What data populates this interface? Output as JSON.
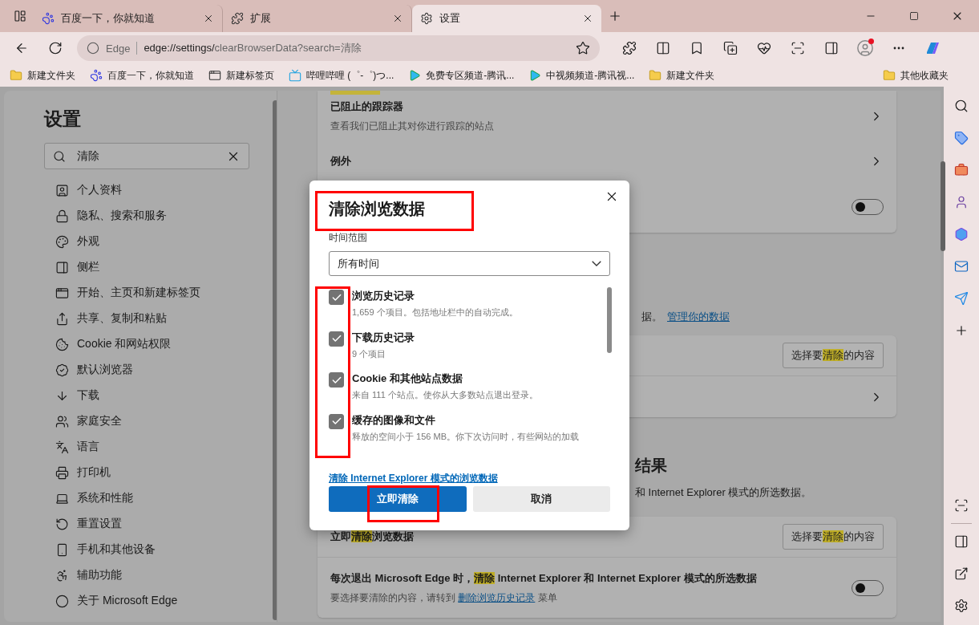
{
  "tabs": [
    {
      "title": "百度一下，你就知道",
      "selected": false
    },
    {
      "title": "扩展",
      "selected": false
    },
    {
      "title": "设置",
      "selected": true
    }
  ],
  "address": {
    "site": "Edge",
    "url_host": "edge://settings/",
    "url_rest": "clearBrowserData?search=清除"
  },
  "bookmarks": [
    {
      "label": "新建文件夹",
      "kind": "folder"
    },
    {
      "label": "百度一下，你就知道",
      "kind": "paw"
    },
    {
      "label": "新建标签页",
      "kind": "page"
    },
    {
      "label": "哔哩哔哩 (゜-゜)つ...",
      "kind": "tv"
    },
    {
      "label": "免费专区频道-腾讯...",
      "kind": "play"
    },
    {
      "label": "中视频频道-腾讯视...",
      "kind": "play"
    },
    {
      "label": "新建文件夹",
      "kind": "folder"
    }
  ],
  "other_bookmarks": "其他收藏夹",
  "settings": {
    "title": "设置",
    "search": {
      "value": "清除"
    },
    "nav": [
      "个人资料",
      "隐私、搜索和服务",
      "外观",
      "侧栏",
      "开始、主页和新建标签页",
      "共享、复制和粘贴",
      "Cookie 和网站权限",
      "默认浏览器",
      "下载",
      "家庭安全",
      "语言",
      "打印机",
      "系统和性能",
      "重置设置",
      "手机和其他设备",
      "辅助功能",
      "关于 Microsoft Edge"
    ]
  },
  "content": {
    "tracker_rows": [
      {
        "title": "已阻止的跟踪器",
        "detail": "查看我们已阻止其对你进行跟踪的站点"
      },
      {
        "title": "例外"
      }
    ],
    "strict_toggle": {
      "on": false
    },
    "data_note": "据。",
    "manage_link": "管理你的数据",
    "choose_button": [
      {
        "text": "选择要",
        "highlighted": false
      },
      {
        "text": "清除",
        "highlighted": true
      },
      {
        "text": "的内容",
        "highlighted": false
      }
    ],
    "heading": "结果",
    "ie_note": "和 Internet Explorer 模式的所选数据。",
    "clear_now": [
      {
        "text": "立即",
        "highlighted": false
      },
      {
        "text": "清除",
        "highlighted": true
      },
      {
        "text": "浏览数据",
        "highlighted": false
      }
    ],
    "choose_button_2": [
      {
        "text": "选择要",
        "highlighted": false
      },
      {
        "text": "清除",
        "highlighted": true
      },
      {
        "text": "的内容",
        "highlighted": false
      }
    ],
    "on_exit": [
      {
        "text": "每次退出 Microsoft Edge 时，",
        "highlighted": false
      },
      {
        "text": "清除",
        "highlighted": true
      },
      {
        "text": " Internet Explorer 和 Internet Explorer 模式的所选数据",
        "highlighted": false
      }
    ],
    "on_exit_toggle": {
      "on": false
    },
    "on_exit_detail": "要选择要清除的内容，请转到 ",
    "on_exit_link": "删除浏览历史记录",
    "on_exit_tail": " 菜单"
  },
  "dialog": {
    "title": "清除浏览数据",
    "range_label": "时间范围",
    "range_value": "所有时间",
    "items": [
      {
        "title": "浏览历史记录",
        "detail": "1,659 个项目。包括地址栏中的自动完成。",
        "checked": true
      },
      {
        "title": "下载历史记录",
        "detail": "9 个项目",
        "checked": true
      },
      {
        "title": "Cookie 和其他站点数据",
        "detail": "来自 111 个站点。使你从大多数站点退出登录。",
        "checked": true
      },
      {
        "title": "缓存的图像和文件",
        "detail": "释放的空间小于 156 MB。你下次访问时，有些网站的加载",
        "checked": true
      }
    ],
    "ie_link": "清除 Internet Explorer 模式的浏览数据",
    "primary": "立即清除",
    "cancel": "取消"
  }
}
